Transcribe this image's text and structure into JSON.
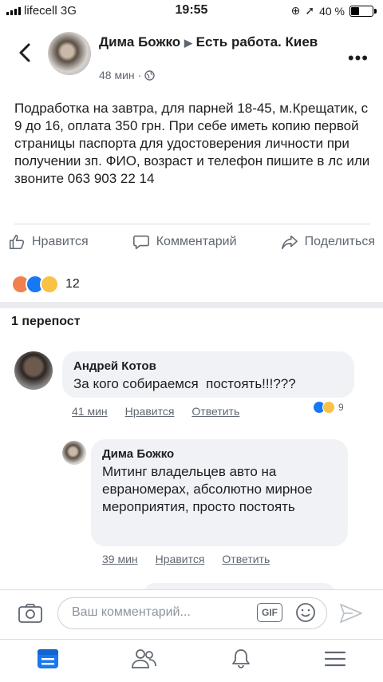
{
  "status": {
    "carrier": "lifecell  3G",
    "time": "19:55",
    "battery": "40 %"
  },
  "post": {
    "author": "Дима Божко",
    "group": "Есть работа. Киев",
    "time": "48 мин",
    "text": "Подработка на завтра, для парней 18-45, м.Крещатик, с 9 до 16, оплата 350 грн. При себе иметь копию первой страницы паспорта для удостоверения личности при получении зп. ФИО, возраст и телефон пишите в лс или звоните 063 903 22 14",
    "actions": {
      "like": "Нравится",
      "comment": "Комментарий",
      "share": "Поделиться"
    },
    "reactions_count": "12",
    "shares": "1 перепост"
  },
  "comments": [
    {
      "author": "Андрей Котов",
      "text": "За кого собираемся  постоять!!!???",
      "time": "41 мин",
      "like": "Нравится",
      "reply": "Ответить",
      "reactions_count": "9"
    },
    {
      "author": "Дима Божко",
      "text": "Митинг владельцев авто на евраномерах, абсолютно мирное мероприятия, просто постоять",
      "time": "39 мин",
      "like": "Нравится",
      "reply": "Ответить"
    }
  ],
  "input": {
    "placeholder": "Ваш комментарий...",
    "gif": "GIF"
  },
  "tabs": [
    "news-feed",
    "friends",
    "notifications",
    "menu"
  ],
  "colors": {
    "accent": "#1877f2",
    "muted": "#606770",
    "bubble": "#f0f2f5"
  }
}
